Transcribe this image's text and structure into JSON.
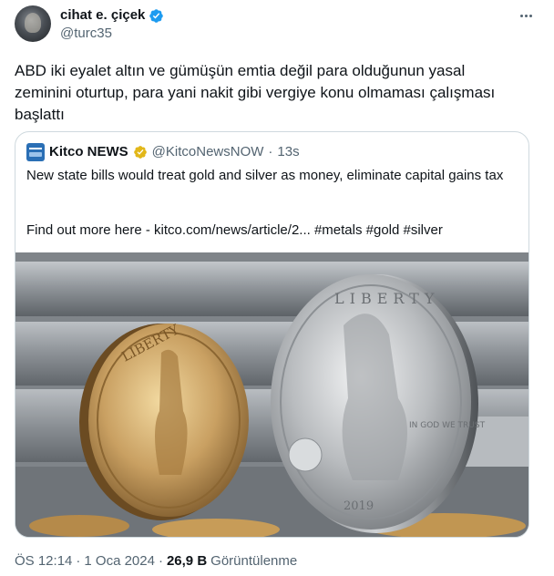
{
  "author": {
    "display_name": "cihat e. çiçek",
    "handle": "@turc35",
    "verified_icon": "verified-badge-icon",
    "verified_color": "#1d9bf0"
  },
  "tweet": {
    "text": "ABD iki eyalet altın ve gümüşün emtia değil para olduğunun yasal zeminini oturtup, para yani nakit gibi vergiye konu olmaması çalışması başlattı"
  },
  "quote": {
    "name": "Kitco NEWS",
    "handle": "@KitcoNewsNOW",
    "dot": "·",
    "time": "13s",
    "badge_color": "#e2b719",
    "text": "New state bills would treat gold and silver as money, eliminate capital gains tax",
    "link_line": "Find out more here - kitco.com/news/article/2... #metals #gold #silver",
    "media": {
      "gold_coin_text": "LIBERTY",
      "silver_coin_text": "LIBERTY",
      "silver_coin_motto": "IN GOD WE TRUST",
      "silver_coin_year": "2019"
    }
  },
  "footer": {
    "time": "ÖS 12:14",
    "dot1": "·",
    "date": "1 Oca 2024",
    "dot2": "·",
    "views_count": "26,9 B",
    "views_label": "Görüntülenme"
  }
}
